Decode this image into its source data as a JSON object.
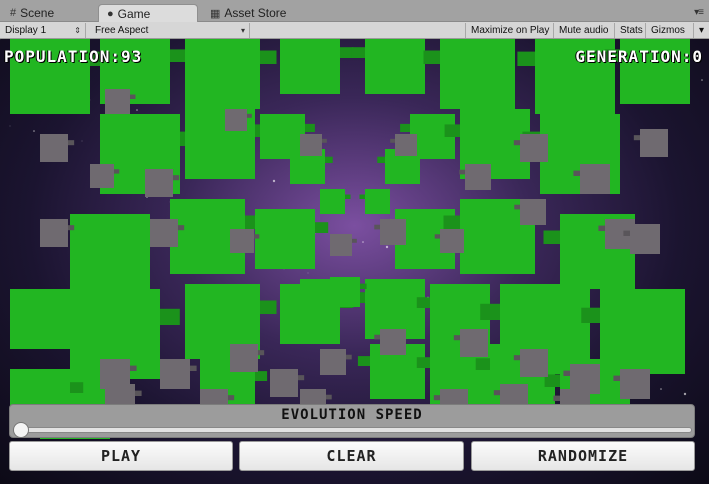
{
  "tabs": [
    {
      "label": "Scene",
      "icon": "scene-icon"
    },
    {
      "label": "Game",
      "icon": "game-icon"
    },
    {
      "label": "Asset Store",
      "icon": "asset-store-icon"
    }
  ],
  "toolbar": {
    "display": "Display 1",
    "aspect": "Free Aspect",
    "maximize_on_play": "Maximize on Play",
    "mute_audio": "Mute audio",
    "stats": "Stats",
    "gizmos": "Gizmos"
  },
  "hud": {
    "population_label": "POPULATION:",
    "population_value": "93",
    "generation_label": "GENERATION:",
    "generation_value": "0"
  },
  "controls": {
    "speed_label": "EVOLUTION SPEED",
    "speed_value": 0.0,
    "play": "PLAY",
    "clear": "CLEAR",
    "randomize": "RANDOMIZE"
  },
  "colors": {
    "cube_live": "#22b622",
    "cube_dead": "#6f6a70"
  }
}
